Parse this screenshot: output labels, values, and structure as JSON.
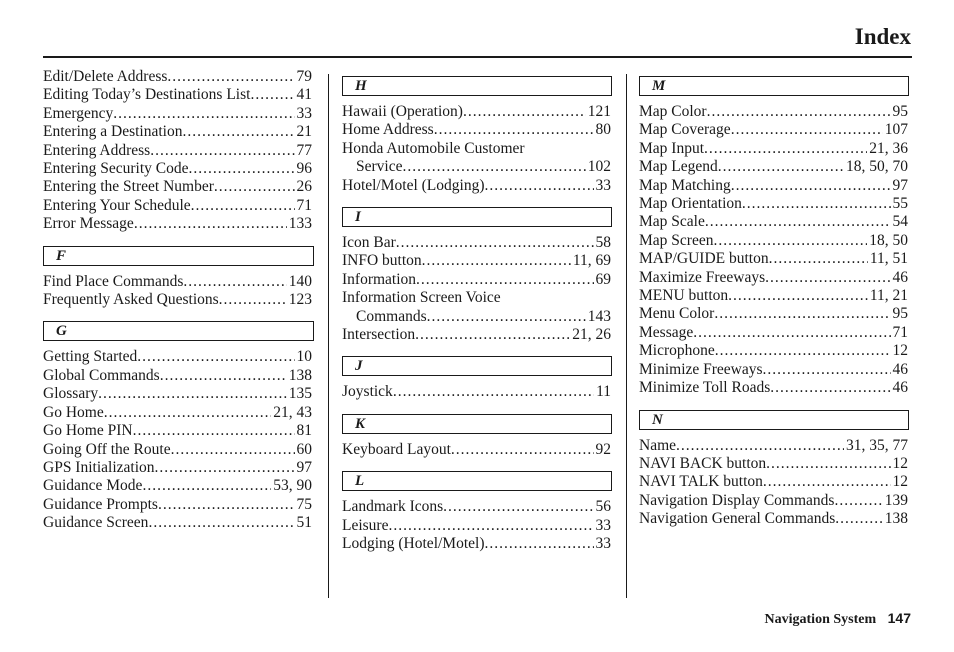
{
  "header": {
    "title": "Index"
  },
  "footer": {
    "book_title": "Navigation System",
    "page_number": "147"
  },
  "columns": [
    {
      "sections": [
        {
          "letter": "",
          "entries": [
            {
              "label": "Edit/Delete Address",
              "page": "79"
            },
            {
              "label": "Editing Today’s Destinations List",
              "page": "41"
            },
            {
              "label": "Emergency",
              "page": "33"
            },
            {
              "label": "Entering a Destination",
              "page": "21"
            },
            {
              "label": "Entering Address",
              "page": "77"
            },
            {
              "label": "Entering Security Code",
              "page": "96"
            },
            {
              "label": "Entering the Street Number",
              "page": "26"
            },
            {
              "label": "Entering Your Schedule",
              "page": "71"
            },
            {
              "label": "Error Message",
              "page": "133"
            }
          ]
        },
        {
          "letter": "F",
          "entries": [
            {
              "label": "Find Place Commands",
              "page": "140"
            },
            {
              "label": "Frequently Asked Questions",
              "page": "123"
            }
          ]
        },
        {
          "letter": "G",
          "entries": [
            {
              "label": "Getting Started",
              "page": "10"
            },
            {
              "label": "Global Commands",
              "page": "138"
            },
            {
              "label": "Glossary",
              "page": "135"
            },
            {
              "label": "Go Home",
              "page": "21, 43"
            },
            {
              "label": "Go Home PIN",
              "page": "81"
            },
            {
              "label": "Going Off the Route",
              "page": "60"
            },
            {
              "label": "GPS Initialization",
              "page": "97"
            },
            {
              "label": "Guidance Mode",
              "page": "53, 90"
            },
            {
              "label": "Guidance Prompts",
              "page": "75"
            },
            {
              "label": "Guidance Screen",
              "page": "51"
            }
          ]
        }
      ]
    },
    {
      "sections": [
        {
          "letter": "H",
          "entries": [
            {
              "label": "Hawaii (Operation)",
              "page": "121"
            },
            {
              "label": "Home Address",
              "page": "80"
            },
            {
              "label": "Honda Automobile Customer",
              "continuation": "Service",
              "page": "102"
            },
            {
              "label": "Hotel/Motel (Lodging)",
              "page": "33"
            }
          ]
        },
        {
          "letter": "I",
          "entries": [
            {
              "label": "Icon Bar",
              "page": "58"
            },
            {
              "label": "INFO button",
              "page": "11, 69"
            },
            {
              "label": "Information",
              "page": "69"
            },
            {
              "label": "Information Screen Voice",
              "continuation": "Commands",
              "page": "143"
            },
            {
              "label": "Intersection",
              "page": "21, 26"
            }
          ]
        },
        {
          "letter": "J",
          "entries": [
            {
              "label": "Joystick",
              "page": "11"
            }
          ]
        },
        {
          "letter": "K",
          "entries": [
            {
              "label": "Keyboard Layout",
              "page": "92"
            }
          ]
        },
        {
          "letter": "L",
          "entries": [
            {
              "label": "Landmark Icons",
              "page": "56"
            },
            {
              "label": "Leisure",
              "page": "33"
            },
            {
              "label": "Lodging (Hotel/Motel)",
              "page": "33"
            }
          ]
        }
      ]
    },
    {
      "sections": [
        {
          "letter": "M",
          "entries": [
            {
              "label": "Map Color",
              "page": "95"
            },
            {
              "label": "Map Coverage",
              "page": "107"
            },
            {
              "label": "Map Input",
              "page": "21, 36"
            },
            {
              "label": "Map Legend",
              "page": "18, 50, 70"
            },
            {
              "label": "Map Matching",
              "page": "97"
            },
            {
              "label": "Map Orientation",
              "page": "55"
            },
            {
              "label": "Map Scale",
              "page": "54"
            },
            {
              "label": "Map Screen",
              "page": "18, 50"
            },
            {
              "label": "MAP/GUIDE button",
              "page": "11, 51"
            },
            {
              "label": "Maximize Freeways",
              "page": "46"
            },
            {
              "label": "MENU button",
              "page": "11, 21"
            },
            {
              "label": "Menu Color",
              "page": "95"
            },
            {
              "label": "Message",
              "page": "71"
            },
            {
              "label": "Microphone",
              "page": "12"
            },
            {
              "label": "Minimize Freeways",
              "page": "46"
            },
            {
              "label": "Minimize Toll Roads",
              "page": "46"
            }
          ]
        },
        {
          "letter": "N",
          "entries": [
            {
              "label": "Name",
              "page": "31, 35, 77"
            },
            {
              "label": "NAVI BACK button",
              "page": "12"
            },
            {
              "label": "NAVI TALK button",
              "page": "12"
            },
            {
              "label": "Navigation Display Commands",
              "page": "139"
            },
            {
              "label": "Navigation General Commands",
              "page": "138"
            }
          ]
        }
      ]
    }
  ]
}
